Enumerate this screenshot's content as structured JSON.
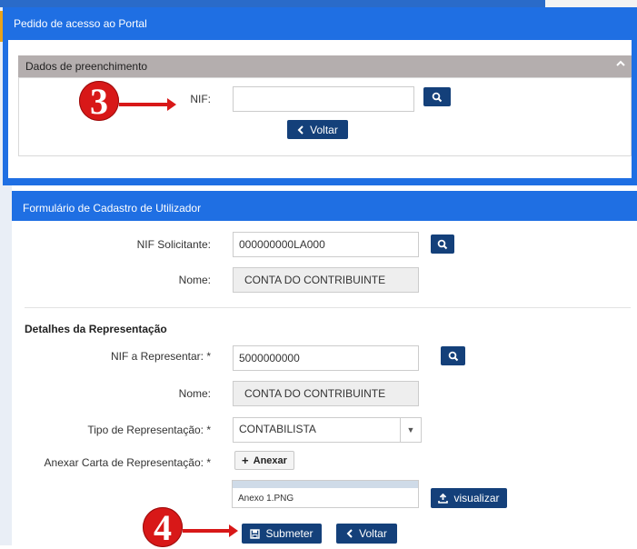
{
  "panel1": {
    "title": "Pedido de acesso ao Portal",
    "section": "Dados de preenchimento",
    "nif_label": "NIF:",
    "nif_value": "",
    "back_label": "Voltar"
  },
  "panel2": {
    "title": "Formulário de Cadastro de Utilizador",
    "nif_solicitante_label": "NIF Solicitante:",
    "nif_solicitante_value": "000000000LA000",
    "nome_label": "Nome:",
    "nome_value": "CONTA DO CONTRIBUINTE",
    "details_title": "Detalhes da Representação",
    "nif_representar_label": "NIF a Representar: *",
    "nif_representar_value": "5000000000",
    "nome2_label": "Nome:",
    "nome2_value": "CONTA DO CONTRIBUINTE",
    "tipo_label": "Tipo de Representação: *",
    "tipo_value": "CONTABILISTA",
    "anexar_label": "Anexar Carta de Representação: *",
    "anexar_button": "Anexar",
    "file_name": "Anexo 1.PNG",
    "visualizar_button": "visualizar",
    "submit_button": "Submeter",
    "back_button": "Voltar"
  },
  "annotations": {
    "step3": "3",
    "step4": "4"
  },
  "colors": {
    "panel_blue": "#1f6fe3",
    "button_navy": "#14407a",
    "annotation_red": "#d81818",
    "subheader_gray": "#b4aeae"
  },
  "icons": [
    "search-icon",
    "chevron-left-icon",
    "chevron-up-icon",
    "caret-down-icon",
    "plus-icon",
    "upload-icon",
    "save-icon"
  ]
}
